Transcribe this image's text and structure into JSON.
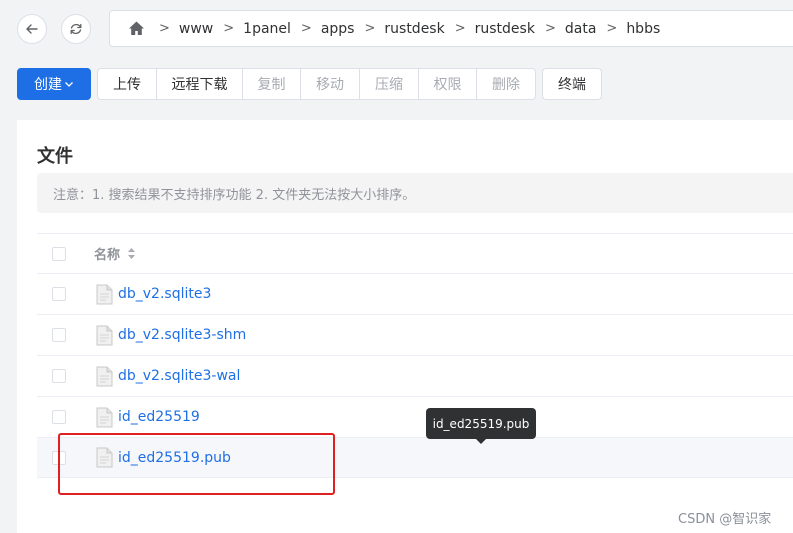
{
  "nav": {
    "back_icon": "arrow-left-icon",
    "refresh_icon": "refresh-icon"
  },
  "breadcrumb": {
    "home_icon": "home-icon",
    "separator": ">",
    "items": [
      "www",
      "1panel",
      "apps",
      "rustdesk",
      "rustdesk",
      "data",
      "hbbs"
    ]
  },
  "toolbar": {
    "create_label": "创建",
    "actions": [
      {
        "label": "上传",
        "enabled": true
      },
      {
        "label": "远程下载",
        "enabled": true
      },
      {
        "label": "复制",
        "enabled": false
      },
      {
        "label": "移动",
        "enabled": false
      },
      {
        "label": "压缩",
        "enabled": false
      },
      {
        "label": "权限",
        "enabled": false
      },
      {
        "label": "删除",
        "enabled": false
      }
    ],
    "terminal_label": "终端"
  },
  "card": {
    "title": "文件",
    "notice": "注意：1. 搜索结果不支持排序功能 2. 文件夹无法按大小排序。"
  },
  "table": {
    "column_name": "名称",
    "rows": [
      {
        "name": "db_v2.sqlite3"
      },
      {
        "name": "db_v2.sqlite3-shm"
      },
      {
        "name": "db_v2.sqlite3-wal"
      },
      {
        "name": "id_ed25519"
      },
      {
        "name": "id_ed25519.pub"
      }
    ]
  },
  "tooltip": {
    "text": "id_ed25519.pub"
  },
  "colors": {
    "primary": "#1e6fe6",
    "highlight": "#e02020",
    "tooltip_bg": "#303133"
  },
  "watermark": "CSDN @智识家"
}
